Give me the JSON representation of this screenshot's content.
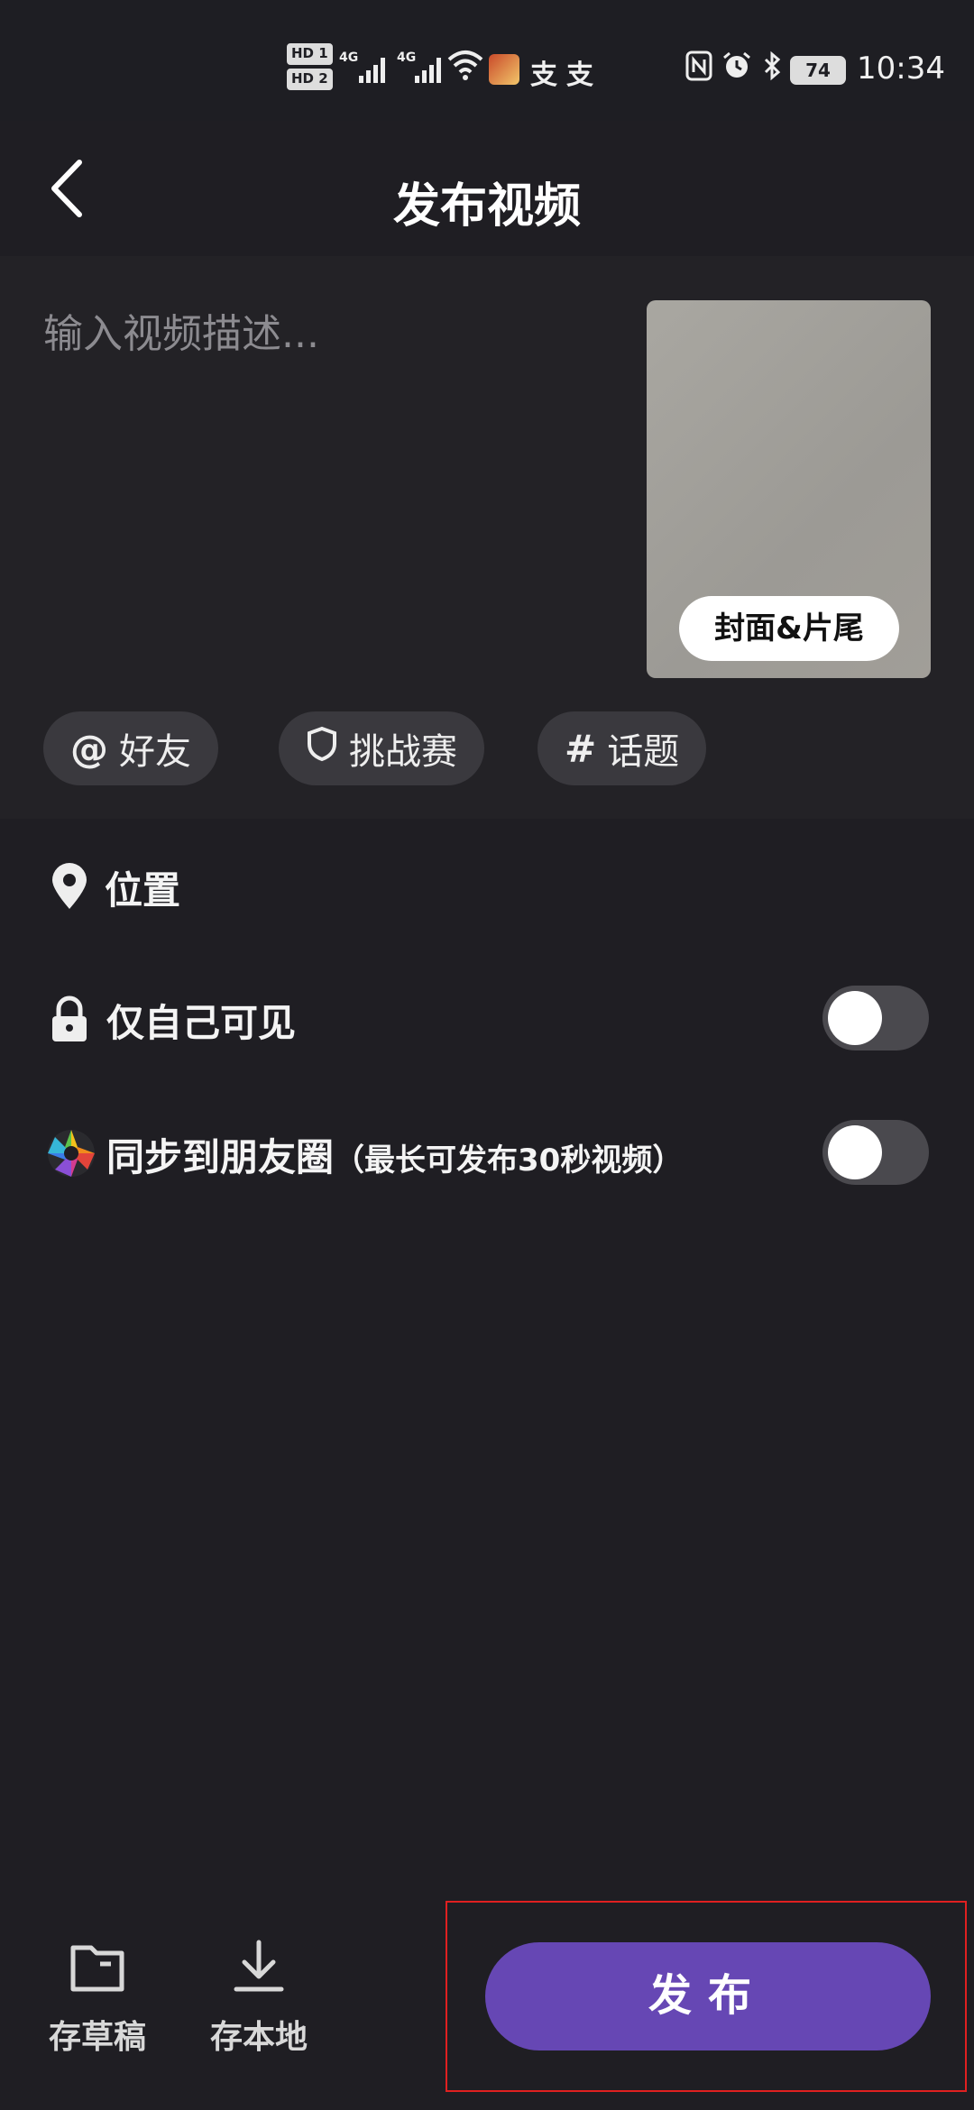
{
  "status_bar": {
    "hd1": "HD 1",
    "hd2": "HD 2",
    "net1": "4G",
    "net2": "4G",
    "msg_icon1": "支",
    "msg_icon2": "支",
    "battery": "74",
    "time": "10:34",
    "icons": [
      "hd-icon",
      "signal-icon",
      "wifi-icon",
      "game-app-icon",
      "alipay-icon",
      "nfc-icon",
      "alarm-icon",
      "bluetooth-icon",
      "battery-icon"
    ]
  },
  "header": {
    "title": "发布视频",
    "back_icon": "chevron-left-icon"
  },
  "description": {
    "placeholder": "输入视频描述...",
    "value": ""
  },
  "cover": {
    "button_label": "封面&片尾"
  },
  "chips": [
    {
      "icon": "@",
      "label": "好友"
    },
    {
      "icon": "shield",
      "label": "挑战赛"
    },
    {
      "icon": "#",
      "label": "话题"
    }
  ],
  "options": {
    "location": {
      "label": "位置",
      "icon": "location-pin-icon"
    },
    "private": {
      "label": "仅自己可见",
      "icon": "lock-icon",
      "enabled": false
    },
    "moments": {
      "label": "同步到朋友圈",
      "note": "（最长可发布30秒视频）",
      "icon": "moments-icon",
      "enabled": false
    }
  },
  "bottom": {
    "draft_label": "存草稿",
    "local_label": "存本地",
    "publish_label": "发布"
  },
  "colors": {
    "background": "#1f1e23",
    "panel": "#232226",
    "chip": "#3a393e",
    "accent": "#6647b4",
    "highlight": "#e02020"
  }
}
